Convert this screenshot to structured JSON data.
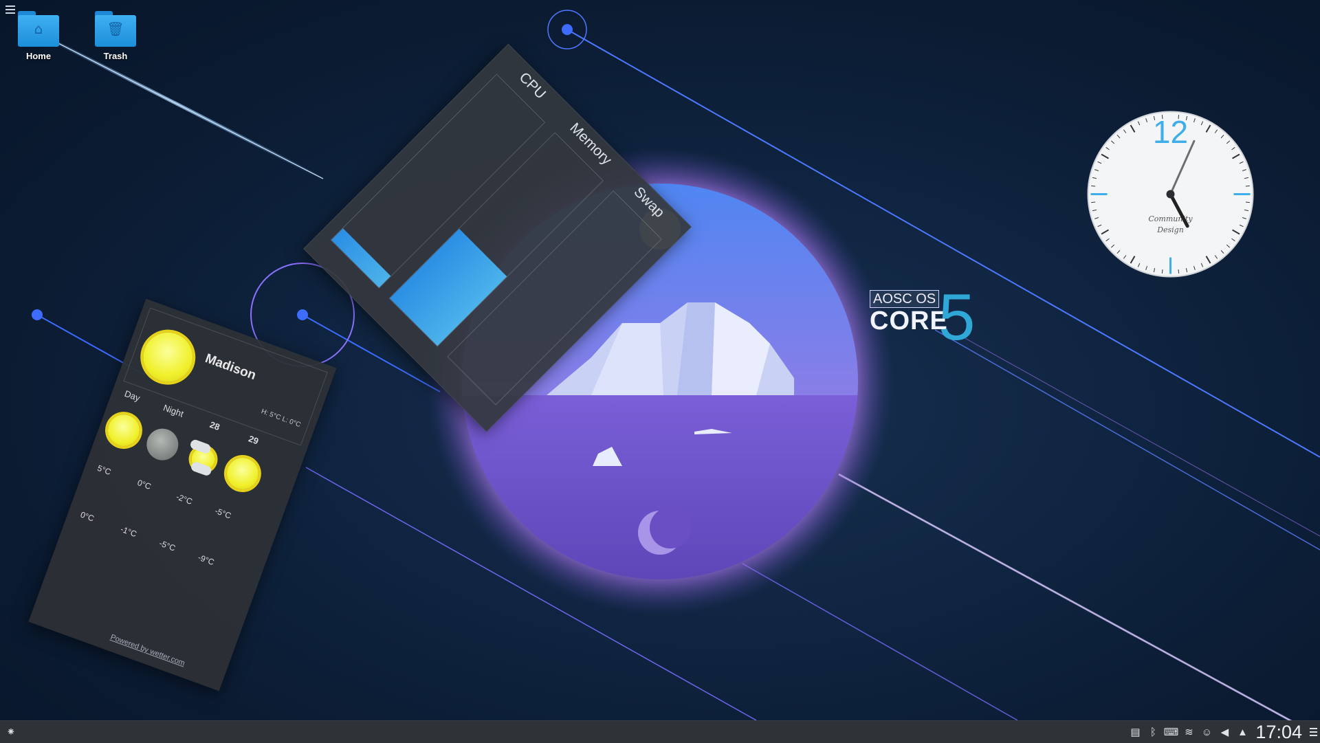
{
  "desktop": {
    "icons": [
      {
        "label": "Home",
        "icon": "home-icon"
      },
      {
        "label": "Trash",
        "icon": "trash-icon"
      }
    ]
  },
  "system_monitor": {
    "columns": [
      {
        "label": "CPU",
        "usage_fraction": 0.07
      },
      {
        "label": "Memory",
        "usage_fraction": 0.42
      },
      {
        "label": "Swap",
        "usage_fraction": 0.0
      }
    ],
    "accent": "#3daee9"
  },
  "weather": {
    "city": "Madison",
    "high_low": "H: 5°C L: 0°C",
    "day_label": "Day",
    "night_label": "Night",
    "dates": [
      "28",
      "29"
    ],
    "forecast": [
      {
        "icon": "sun-icon",
        "high": "5°C",
        "low": "0°C"
      },
      {
        "icon": "moon-icon",
        "high": "0°C",
        "low": "-1°C"
      },
      {
        "icon": "sun-cloud-icon",
        "high": "-2°C",
        "low": "-5°C"
      },
      {
        "icon": "sun-icon",
        "high": "-5°C",
        "low": "-9°C"
      }
    ],
    "powered_by": "Powered by wetter.com"
  },
  "clock": {
    "numeral": "12",
    "brand_line1": "Community",
    "brand_line2": "Design",
    "time_hours": 17,
    "time_minutes": 4,
    "accent": "#3daee9"
  },
  "logo": {
    "top": "AOSC OS",
    "core": "CORE",
    "version": "5"
  },
  "taskbar": {
    "time": "17:04",
    "tray_icons": [
      "clipboard-icon",
      "bluetooth-icon",
      "keyboard-icon",
      "wifi-icon",
      "user-icon",
      "volume-icon",
      "expand-arrow-icon"
    ]
  },
  "colors": {
    "background": "#0f2440",
    "panel": "#2f3237",
    "planet_top": "#5a7ef0",
    "planet_bottom": "#6b50c6",
    "glow": "#b47af0"
  }
}
